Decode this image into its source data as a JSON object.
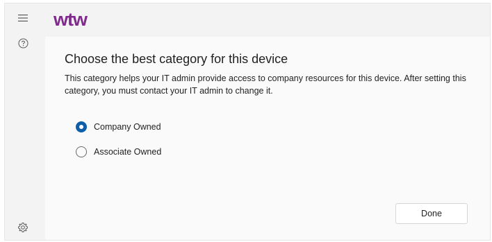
{
  "brand": {
    "logo_text": "wtw",
    "color": "#7f2a8c"
  },
  "rail": {
    "menu_icon": "hamburger-icon",
    "help_icon": "help-circle-icon",
    "settings_icon": "gear-icon"
  },
  "page": {
    "title": "Choose the best category for this device",
    "description": "This category helps your IT admin provide access to company resources for this device. After setting this category, you must contact your IT admin to change it."
  },
  "options": [
    {
      "label": "Company Owned",
      "selected": true
    },
    {
      "label": "Associate Owned",
      "selected": false
    }
  ],
  "actions": {
    "done_label": "Done"
  },
  "colors": {
    "accent": "#0f5fa8",
    "background": "#f3f3f3"
  }
}
